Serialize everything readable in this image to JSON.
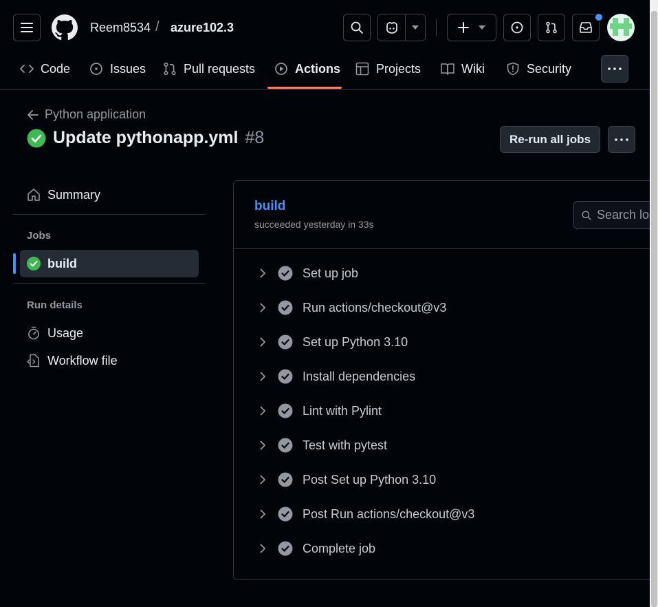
{
  "header": {
    "owner": "Reem8534",
    "separator": "/",
    "repo": "azure102.3",
    "tabs": [
      {
        "label": "Code",
        "icon": "code-icon"
      },
      {
        "label": "Issues",
        "icon": "issue-opened-icon"
      },
      {
        "label": "Pull requests",
        "icon": "git-pull-request-icon"
      },
      {
        "label": "Actions",
        "icon": "play-icon",
        "active": true
      },
      {
        "label": "Projects",
        "icon": "table-icon"
      },
      {
        "label": "Wiki",
        "icon": "book-icon"
      },
      {
        "label": "Security",
        "icon": "shield-icon"
      }
    ]
  },
  "run": {
    "back_label": "Python application",
    "title": "Update pythonapp.yml",
    "number": "#8",
    "rerun_label": "Re-run all jobs"
  },
  "sidebar": {
    "summary_label": "Summary",
    "jobs_heading": "Jobs",
    "job_label": "build",
    "run_details_heading": "Run details",
    "usage_label": "Usage",
    "workflow_label": "Workflow file"
  },
  "job": {
    "title": "build",
    "subtitle": "succeeded yesterday in 33s",
    "search_placeholder": "Search logs",
    "steps": [
      "Set up job",
      "Run actions/checkout@v3",
      "Set up Python 3.10",
      "Install dependencies",
      "Lint with Pylint",
      "Test with pytest",
      "Post Set up Python 3.10",
      "Post Run actions/checkout@v3",
      "Complete job"
    ]
  },
  "colors": {
    "accent_blue": "#4493f8",
    "success_green": "#3fb950",
    "tab_underline": "#f78166",
    "notification_dot": "#4493f8"
  }
}
